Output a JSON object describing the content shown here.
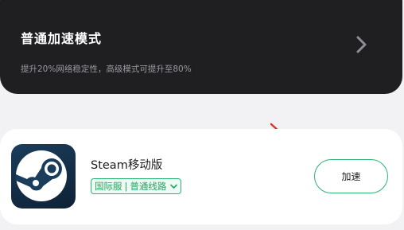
{
  "mode_card": {
    "title": "普通加速模式",
    "subtitle": "提升20%网络稳定性，高级模式可提升至80%",
    "chevron_icon": "chevron-right-icon"
  },
  "game": {
    "name": "Steam移动版",
    "icon": "steam-logo-icon",
    "server_region": "国际服",
    "separator": "|",
    "route": "普通线路",
    "dropdown_icon": "chevron-down-icon",
    "accelerate_label": "加速"
  },
  "colors": {
    "accent_green": "#2bb673",
    "dark_card": "#1f1f22",
    "annotation_red": "#e8322b"
  }
}
